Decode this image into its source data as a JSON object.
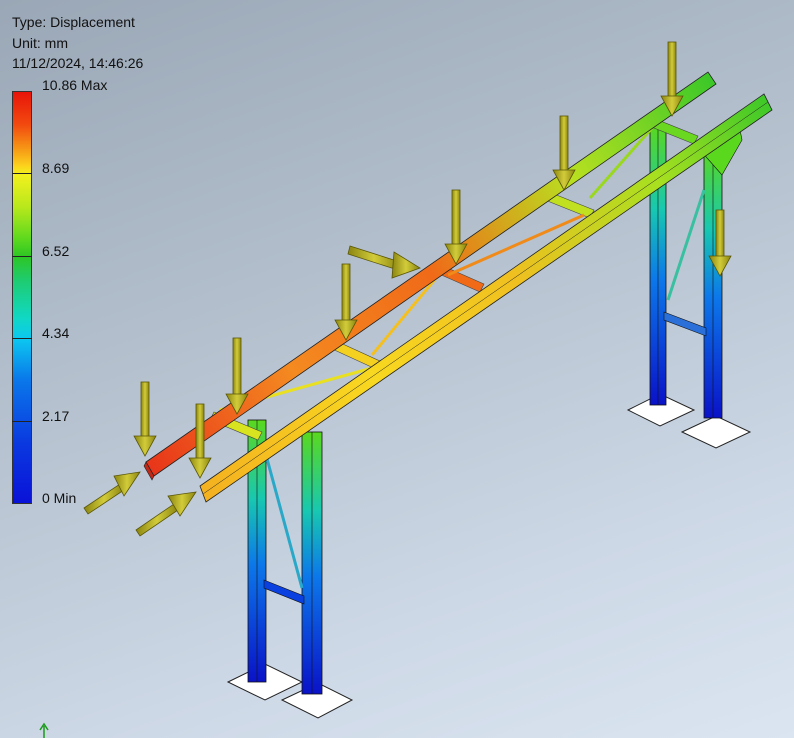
{
  "result": {
    "type_label": "Type: Displacement",
    "unit_label": "Unit: mm",
    "timestamp": "11/12/2024, 14:46:26"
  },
  "legend": {
    "max_label": "10.86 Max",
    "ticks": [
      "8.69",
      "6.52",
      "4.34",
      "2.17"
    ],
    "min_label": "0 Min",
    "colors": {
      "max": "#e8140a",
      "high": "#f4f01e",
      "mid": "#2ec624",
      "low": "#0cc8f0",
      "min": "#0a12d8"
    }
  },
  "scene": {
    "description_icon": "fea-gantry-frame",
    "load_arrow_color": "#b5b020",
    "constraint_color": "#ffffff"
  }
}
